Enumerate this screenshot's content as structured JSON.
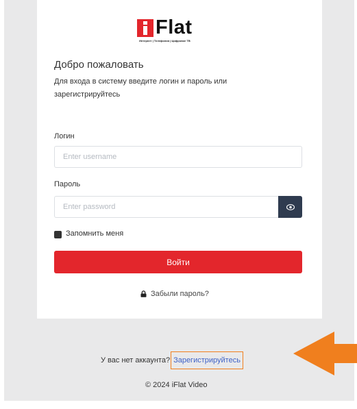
{
  "logo": {
    "text": "Flat",
    "tagline": "Интернет | Телефония | Цифровое ТВ"
  },
  "welcome": {
    "title": "Добро пожаловать",
    "subtitle": "Для входа в систему введите логин и пароль или зарегистрируйтесь"
  },
  "form": {
    "login_label": "Логин",
    "login_placeholder": "Enter username",
    "password_label": "Пароль",
    "password_placeholder": "Enter password",
    "remember_label": "Запомнить меня",
    "submit_label": "Войти",
    "forgot_label": "Забыли пароль?"
  },
  "footer": {
    "no_account": "У вас нет аккаунта?",
    "register_link": "Зарегистрируйтесь",
    "copyright": "© 2024 iFlat Video"
  },
  "colors": {
    "brand_red": "#e3262c",
    "eye_button": "#2f3b4f",
    "link": "#3f62c7",
    "annotation_orange": "#f07f1e"
  },
  "icons": [
    "eye-icon",
    "lock-icon",
    "arrow-left-icon"
  ]
}
